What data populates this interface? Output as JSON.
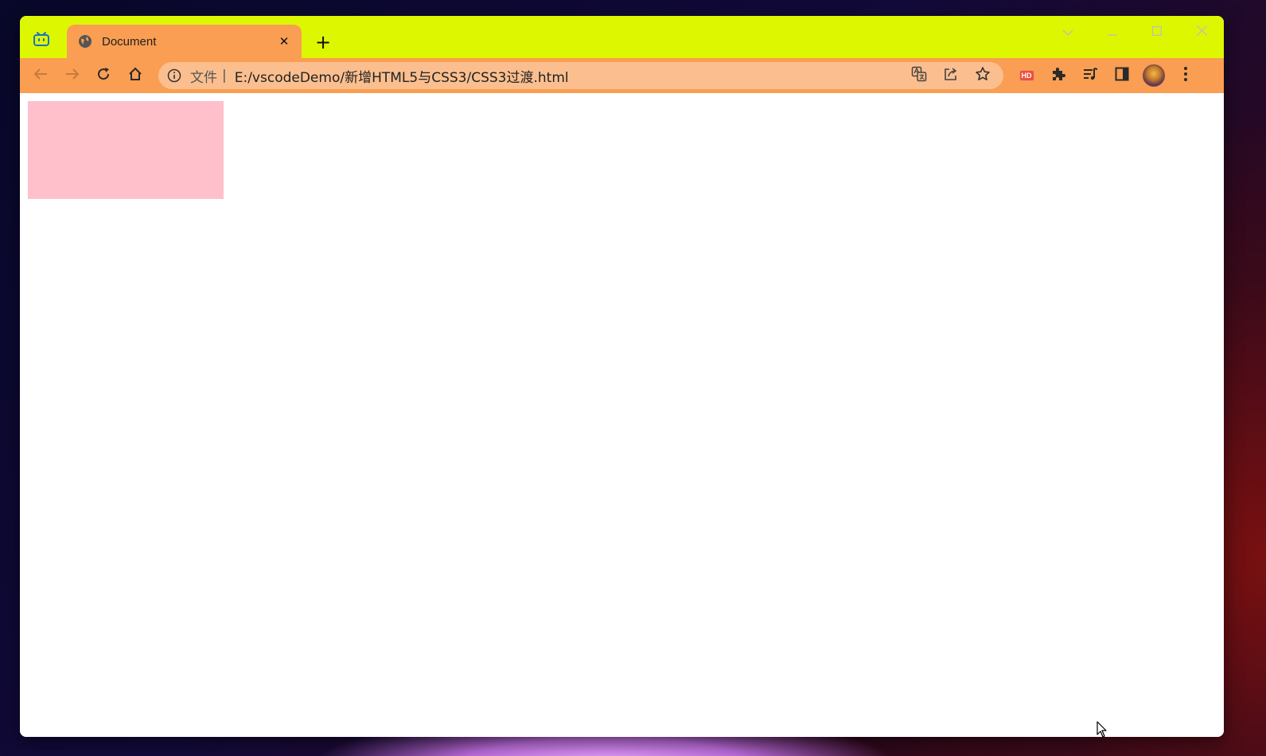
{
  "browser": {
    "tab": {
      "title": "Document",
      "close_symbol": "✕"
    },
    "new_tab_symbol": "+",
    "omnibox": {
      "scheme_label": "文件",
      "separator": "|",
      "url": "E:/vscodeDemo/新增HTML5与CSS3/CSS3过渡.html"
    },
    "extensions": {
      "hd_badge": "HD"
    }
  },
  "page": {
    "box_color": "#ffc0cb"
  },
  "colors": {
    "titlebar": "#ddf700",
    "toolbar": "#f99e52",
    "omnibox": "#fbbf8f"
  }
}
